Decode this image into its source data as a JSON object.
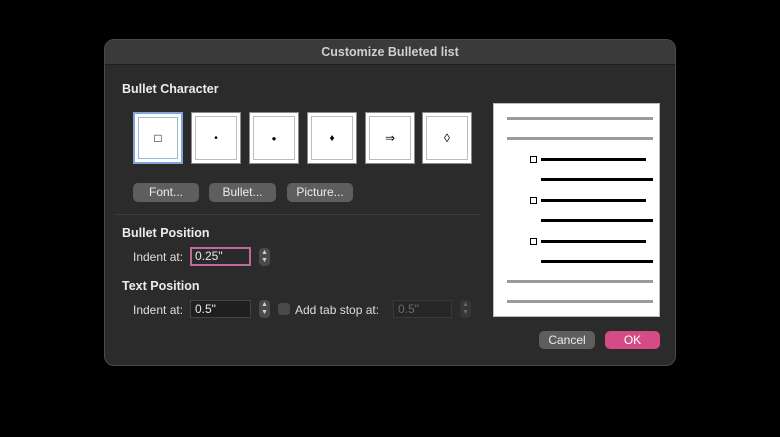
{
  "dialog": {
    "title": "Customize Bulleted list",
    "ok_label": "OK",
    "cancel_label": "Cancel"
  },
  "bullet_character": {
    "label": "Bullet Character",
    "bullets": [
      {
        "glyph": "□",
        "selected": true
      },
      {
        "glyph": "•",
        "selected": false
      },
      {
        "glyph": "●",
        "selected": false
      },
      {
        "glyph": "♦",
        "selected": false
      },
      {
        "glyph": "⇒",
        "selected": false
      },
      {
        "glyph": "◊",
        "selected": false
      }
    ],
    "font_button": "Font...",
    "bullet_button": "Bullet...",
    "picture_button": "Picture..."
  },
  "bullet_position": {
    "label": "Bullet Position",
    "indent_label": "Indent at:",
    "indent_value": "0.25\""
  },
  "text_position": {
    "label": "Text Position",
    "indent_label": "Indent at:",
    "indent_value": "0.5\"",
    "tab_stop_label": "Add tab stop at:",
    "tab_stop_value": "0.5\"",
    "tab_stop_checked": false
  },
  "colors": {
    "accent": "#d44b86",
    "focus_ring": "#c06a9a",
    "selection": "#7fa6d9"
  }
}
